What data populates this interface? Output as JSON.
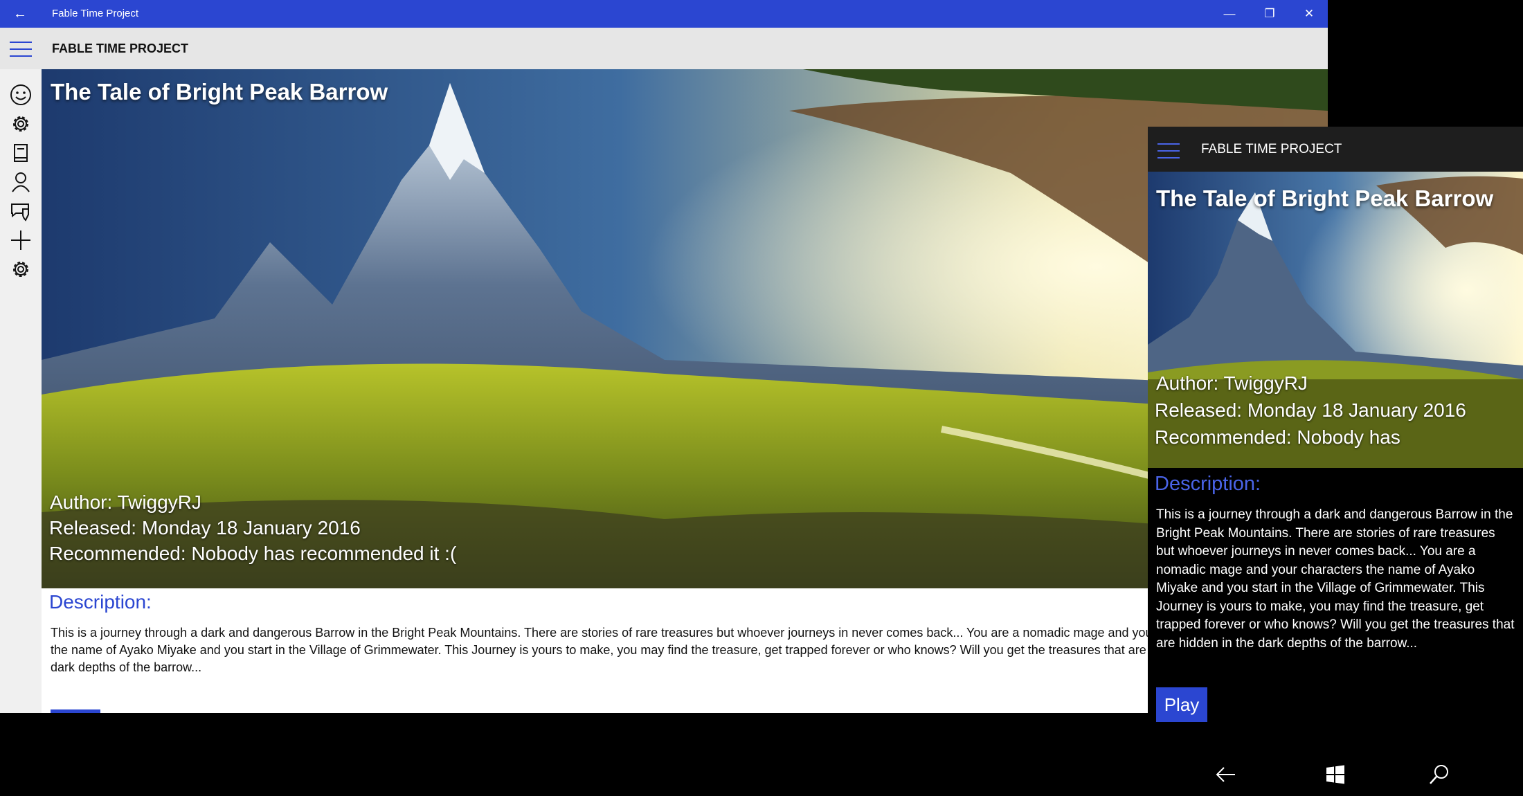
{
  "window": {
    "title": "Fable Time Project",
    "minimize_glyph": "—",
    "maximize_glyph": "❐",
    "close_glyph": "✕",
    "back_glyph": "←"
  },
  "app": {
    "header_title": "FABLE TIME PROJECT"
  },
  "sidebar": {
    "items": [
      {
        "icon": "smiley-icon"
      },
      {
        "icon": "gear-icon"
      },
      {
        "icon": "book-icon"
      },
      {
        "icon": "person-icon"
      },
      {
        "icon": "chat-shield-icon"
      },
      {
        "icon": "plus-icon"
      },
      {
        "icon": "settings-icon"
      }
    ]
  },
  "story": {
    "title": "The Tale of Bright Peak Barrow",
    "author": "Author: TwiggyRJ",
    "released": "Released:  Monday 18 January 2016",
    "recommended": "Recommended:  Nobody has recommended it :(",
    "recommended_truncated": "Recommended:  Nobody has",
    "description_label": "Description:",
    "description": "This is a journey through a dark and dangerous Barrow in the Bright Peak Mountains. There are stories of rare treasures but whoever journeys in never comes back... You are a nomadic mage and your characters the name of Ayako Miyake and you start in the Village of Grimmewater. This Journey is yours to make, you may find the treasure, get trapped forever or who knows? Will you get the treasures that are hidden in the dark depths of the barrow...",
    "play_label": "Play"
  },
  "phone_nav": {
    "icons": [
      "back-arrow-icon",
      "windows-start-icon",
      "search-icon"
    ]
  },
  "colors": {
    "accent": "#2b46d1",
    "phone_accent": "#4a64e8"
  }
}
